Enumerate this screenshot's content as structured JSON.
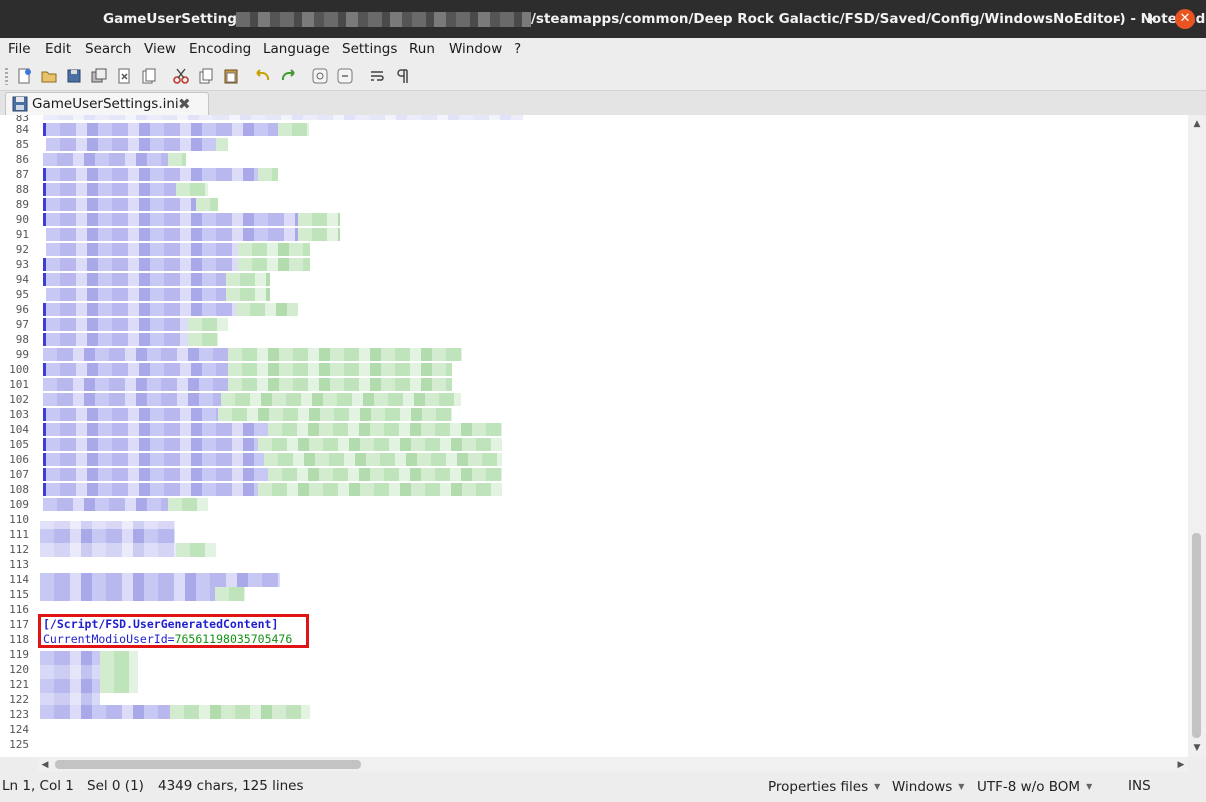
{
  "window": {
    "title_file": "GameUserSettings.ini",
    "title_path": "/steamapps/common/Deep Rock Galactic/FSD/Saved/Config/WindowsNoEditor) - Notepadqq",
    "minimize": "–",
    "maximize": "+",
    "close": "✕"
  },
  "menu": [
    "File",
    "Edit",
    "Search",
    "View",
    "Encoding",
    "Language",
    "Settings",
    "Run",
    "Window",
    "?"
  ],
  "toolbar": {
    "icons": [
      "new-file-icon",
      "open-file-icon",
      "save-icon",
      "save-all-icon",
      "close-file-icon",
      "close-all-icon",
      "cut-icon",
      "copy-icon",
      "paste-icon",
      "undo-icon",
      "redo-icon",
      "zoom-in-icon",
      "zoom-out-icon",
      "word-wrap-icon",
      "show-all-chars-icon"
    ]
  },
  "tab": {
    "label": "GameUserSettings.ini",
    "close": "✖"
  },
  "editor": {
    "line_numbers": [
      "83",
      "84",
      "85",
      "86",
      "87",
      "88",
      "89",
      "90",
      "91",
      "92",
      "93",
      "94",
      "95",
      "96",
      "97",
      "98",
      "99",
      "100",
      "101",
      "102",
      "103",
      "104",
      "105",
      "106",
      "107",
      "108",
      "109",
      "110",
      "111",
      "112",
      "113",
      "114",
      "115",
      "116",
      "117",
      "118",
      "119",
      "120",
      "121",
      "122",
      "123",
      "124",
      "125"
    ],
    "visible_code": {
      "section_header": "[/Script/FSD.UserGeneratedContent]",
      "key": "CurrentModioUserId",
      "equals": "=",
      "value": "76561198035705476"
    }
  },
  "status": {
    "position": "Ln 1, Col 1",
    "selection": "Sel 0 (1)",
    "counts": "4349 chars, 125 lines",
    "language": "Properties files",
    "eol": "Windows",
    "encoding": "UTF-8 w/o BOM",
    "mode": "INS"
  },
  "colors": {
    "accent_close": "#e95420",
    "highlight_box": "#e01414",
    "syntax_section": "#1f1fcf",
    "syntax_value": "#119111"
  }
}
